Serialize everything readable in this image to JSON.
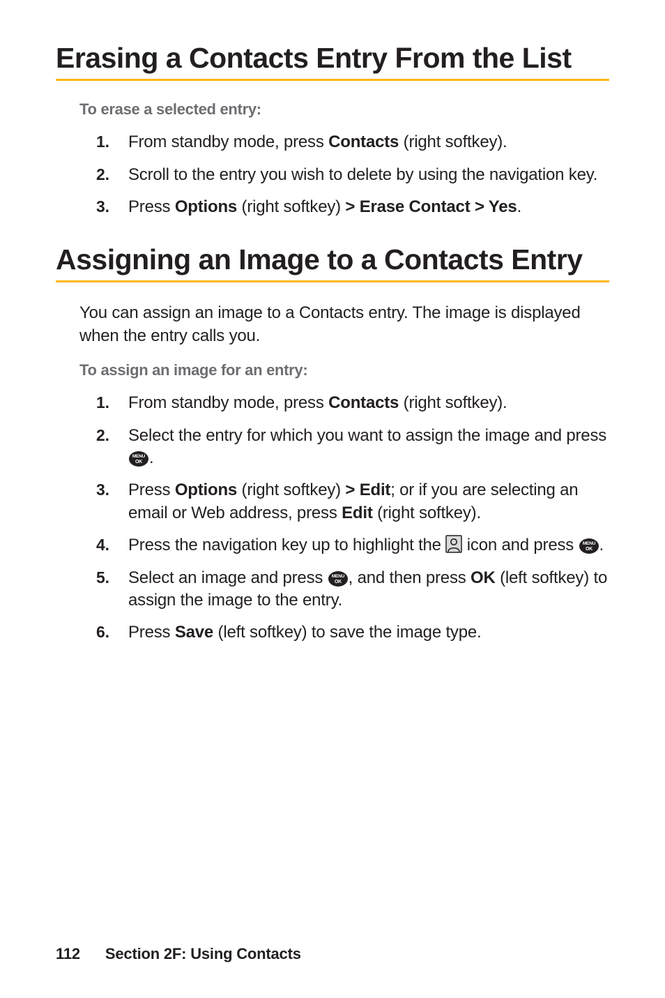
{
  "section1": {
    "title": "Erasing a Contacts Entry From the List",
    "subhead": "To erase a selected entry:",
    "steps": {
      "s1": {
        "pre": "From standby mode, press ",
        "bold": "Contacts",
        "post": " (right softkey)."
      },
      "s2": {
        "text": "Scroll to the entry you wish to delete by using the navigation key."
      },
      "s3": {
        "pre": "Press ",
        "bold1": "Options",
        "mid": " (right softkey) ",
        "bold2": "> Erase Contact > Yes",
        "post": "."
      }
    }
  },
  "section2": {
    "title": "Assigning an Image to a Contacts Entry",
    "intro": "You can assign an image to a Contacts entry. The image is displayed when the entry calls you.",
    "subhead": "To assign an image for an entry:",
    "steps": {
      "s1": {
        "pre": "From standby mode, press ",
        "bold": "Contacts",
        "post": " (right softkey)."
      },
      "s2": {
        "pre": "Select the entry for which you want to assign the image and press ",
        "post": "."
      },
      "s3": {
        "pre": "Press ",
        "bold1": "Options",
        "mid1": " (right softkey) ",
        "bold2": "> Edit",
        "mid2": "; or if you are selecting an email or Web address, press ",
        "bold3": "Edit",
        "post": " (right softkey)."
      },
      "s4": {
        "pre": "Press the navigation key up to highlight the ",
        "mid": " icon and press ",
        "post": "."
      },
      "s5": {
        "pre": "Select an image and press ",
        "mid": ", and then press ",
        "bold": "OK",
        "post": " (left softkey) to assign the image to the entry."
      },
      "s6": {
        "pre": "Press ",
        "bold": "Save",
        "post": " (left softkey) to save the image type."
      }
    }
  },
  "footer": {
    "page_number": "112",
    "section_label": "Section 2F: Using Contacts"
  },
  "icons": {
    "menu_ok": "menu-ok-icon",
    "face": "face-icon"
  },
  "colors": {
    "rule": "#fdb813",
    "text": "#231f20",
    "subhead": "#6d6e71"
  }
}
